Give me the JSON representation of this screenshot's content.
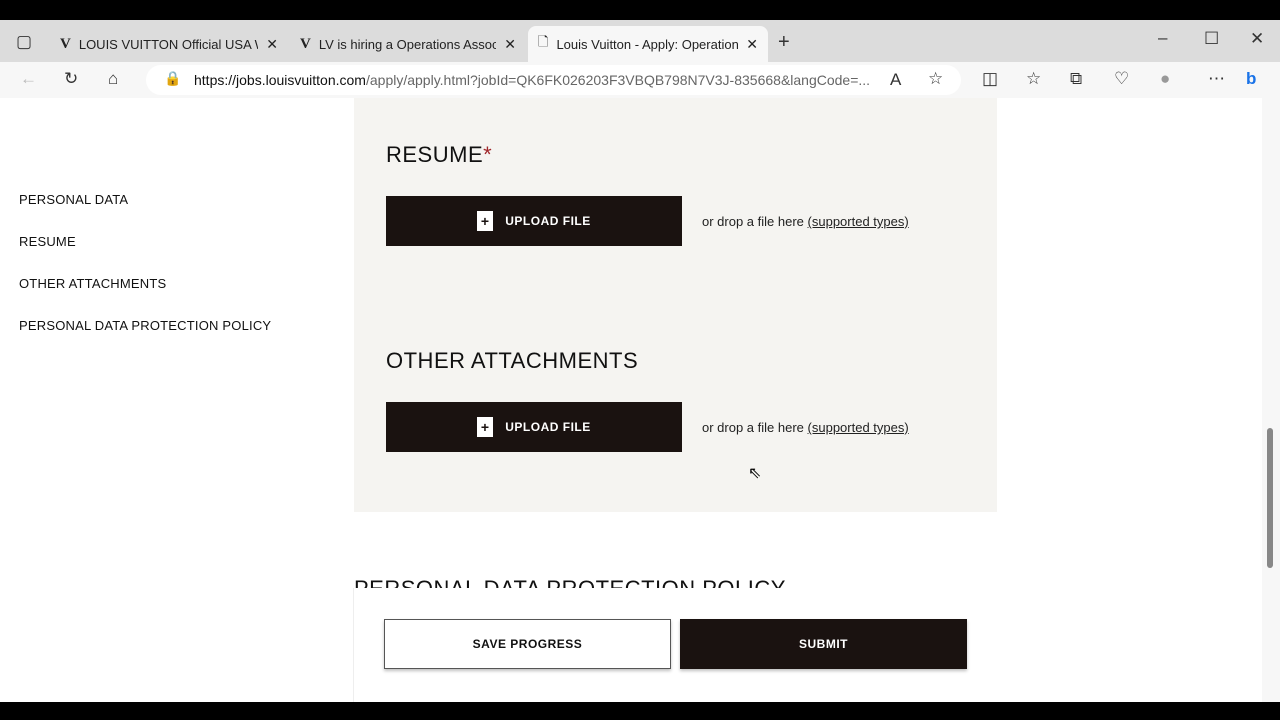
{
  "browser": {
    "tabs": [
      {
        "title": "LOUIS VUITTON Official USA Website",
        "icon": "lv-logo-icon"
      },
      {
        "title": "LV is hiring a Operations Associate",
        "icon": "lv-logo-icon"
      },
      {
        "title": "Louis Vuitton - Apply: Operations",
        "icon": "page-icon"
      }
    ],
    "url_host": "https://jobs.louisvuitton.com",
    "url_path": "/apply/apply.html?jobId=QK6FK026203F3VBQB798N7V3J-835668&langCode=..."
  },
  "sidebar": {
    "items": [
      {
        "label": "PERSONAL DATA"
      },
      {
        "label": "RESUME"
      },
      {
        "label": "OTHER ATTACHMENTS"
      },
      {
        "label": "PERSONAL DATA PROTECTION POLICY"
      }
    ]
  },
  "resume": {
    "title": "RESUME",
    "required": "*",
    "upload_label": "UPLOAD FILE",
    "drop_text": "or drop a file here",
    "supported_link": "(supported types)"
  },
  "attachments": {
    "title": "OTHER ATTACHMENTS",
    "upload_label": "UPLOAD FILE",
    "drop_text": "or drop a file here",
    "supported_link": "(supported types)"
  },
  "policy": {
    "title": "PERSONAL DATA PROTECTION POLICY"
  },
  "footer": {
    "save_label": "SAVE PROGRESS",
    "submit_label": "SUBMIT"
  },
  "colors": {
    "primary": "#1a1210",
    "panel": "#f5f4f1",
    "required": "#a0262a"
  }
}
